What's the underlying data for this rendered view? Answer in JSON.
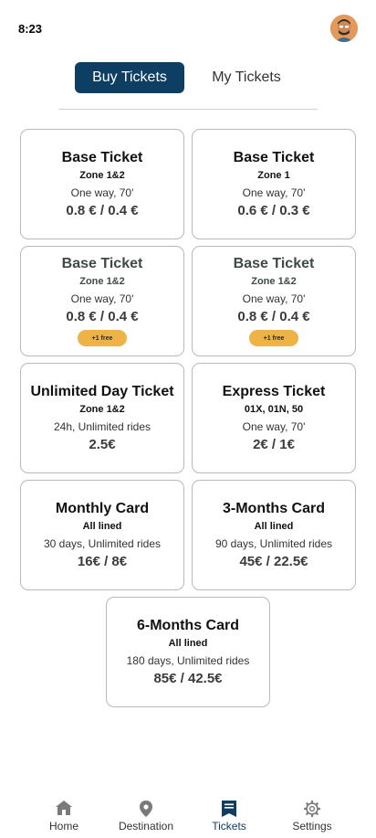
{
  "status_bar": {
    "time": "8:23"
  },
  "tabs": [
    {
      "label": "Buy Tickets",
      "active": true
    },
    {
      "label": "My Tickets",
      "active": false
    }
  ],
  "tickets": [
    {
      "title": "Base Ticket",
      "zone": "Zone 1&2",
      "desc": "One way, 70'",
      "price": "0.8 € / 0.4 €"
    },
    {
      "title": "Base Ticket",
      "zone": "Zone 1",
      "desc": "One way, 70'",
      "price": "0.6 € / 0.3 €"
    },
    {
      "title": "Base Ticket",
      "zone": "Zone 1&2",
      "desc": "One way, 70'",
      "price": "0.8 € / 0.4 €",
      "badge": "+1 free"
    },
    {
      "title": "Base Ticket",
      "zone": "Zone 1&2",
      "desc": "One way, 70'",
      "price": "0.8 € / 0.4 €",
      "badge": "+1 free"
    },
    {
      "title": "Unlimited Day Ticket",
      "zone": "Zone 1&2",
      "desc": "24h, Unlimited rides",
      "price": "2.5€"
    },
    {
      "title": "Express Ticket",
      "zone": "01X, 01N, 50",
      "desc": "One way, 70'",
      "price": "2€ / 1€"
    },
    {
      "title": "Monthly Card",
      "zone": "All lined",
      "desc": "30 days, Unlimited rides",
      "price": "16€ / 8€"
    },
    {
      "title": "3-Months Card",
      "zone": "All lined",
      "desc": "90 days, Unlimited rides",
      "price": "45€ / 22.5€"
    },
    {
      "title": "6-Months Card",
      "zone": "All lined",
      "desc": "180 days, Unlimited rides",
      "price": "85€ / 42.5€"
    }
  ],
  "nav": [
    {
      "label": "Home",
      "icon": "home-icon",
      "active": false
    },
    {
      "label": "Destination",
      "icon": "location-pin-icon",
      "active": false
    },
    {
      "label": "Tickets",
      "icon": "ticket-icon",
      "active": true
    },
    {
      "label": "Settings",
      "icon": "gear-icon",
      "active": false
    }
  ],
  "colors": {
    "primary": "#0e3f63",
    "badge": "#eeb246",
    "card_border": "#b9b9b9"
  }
}
